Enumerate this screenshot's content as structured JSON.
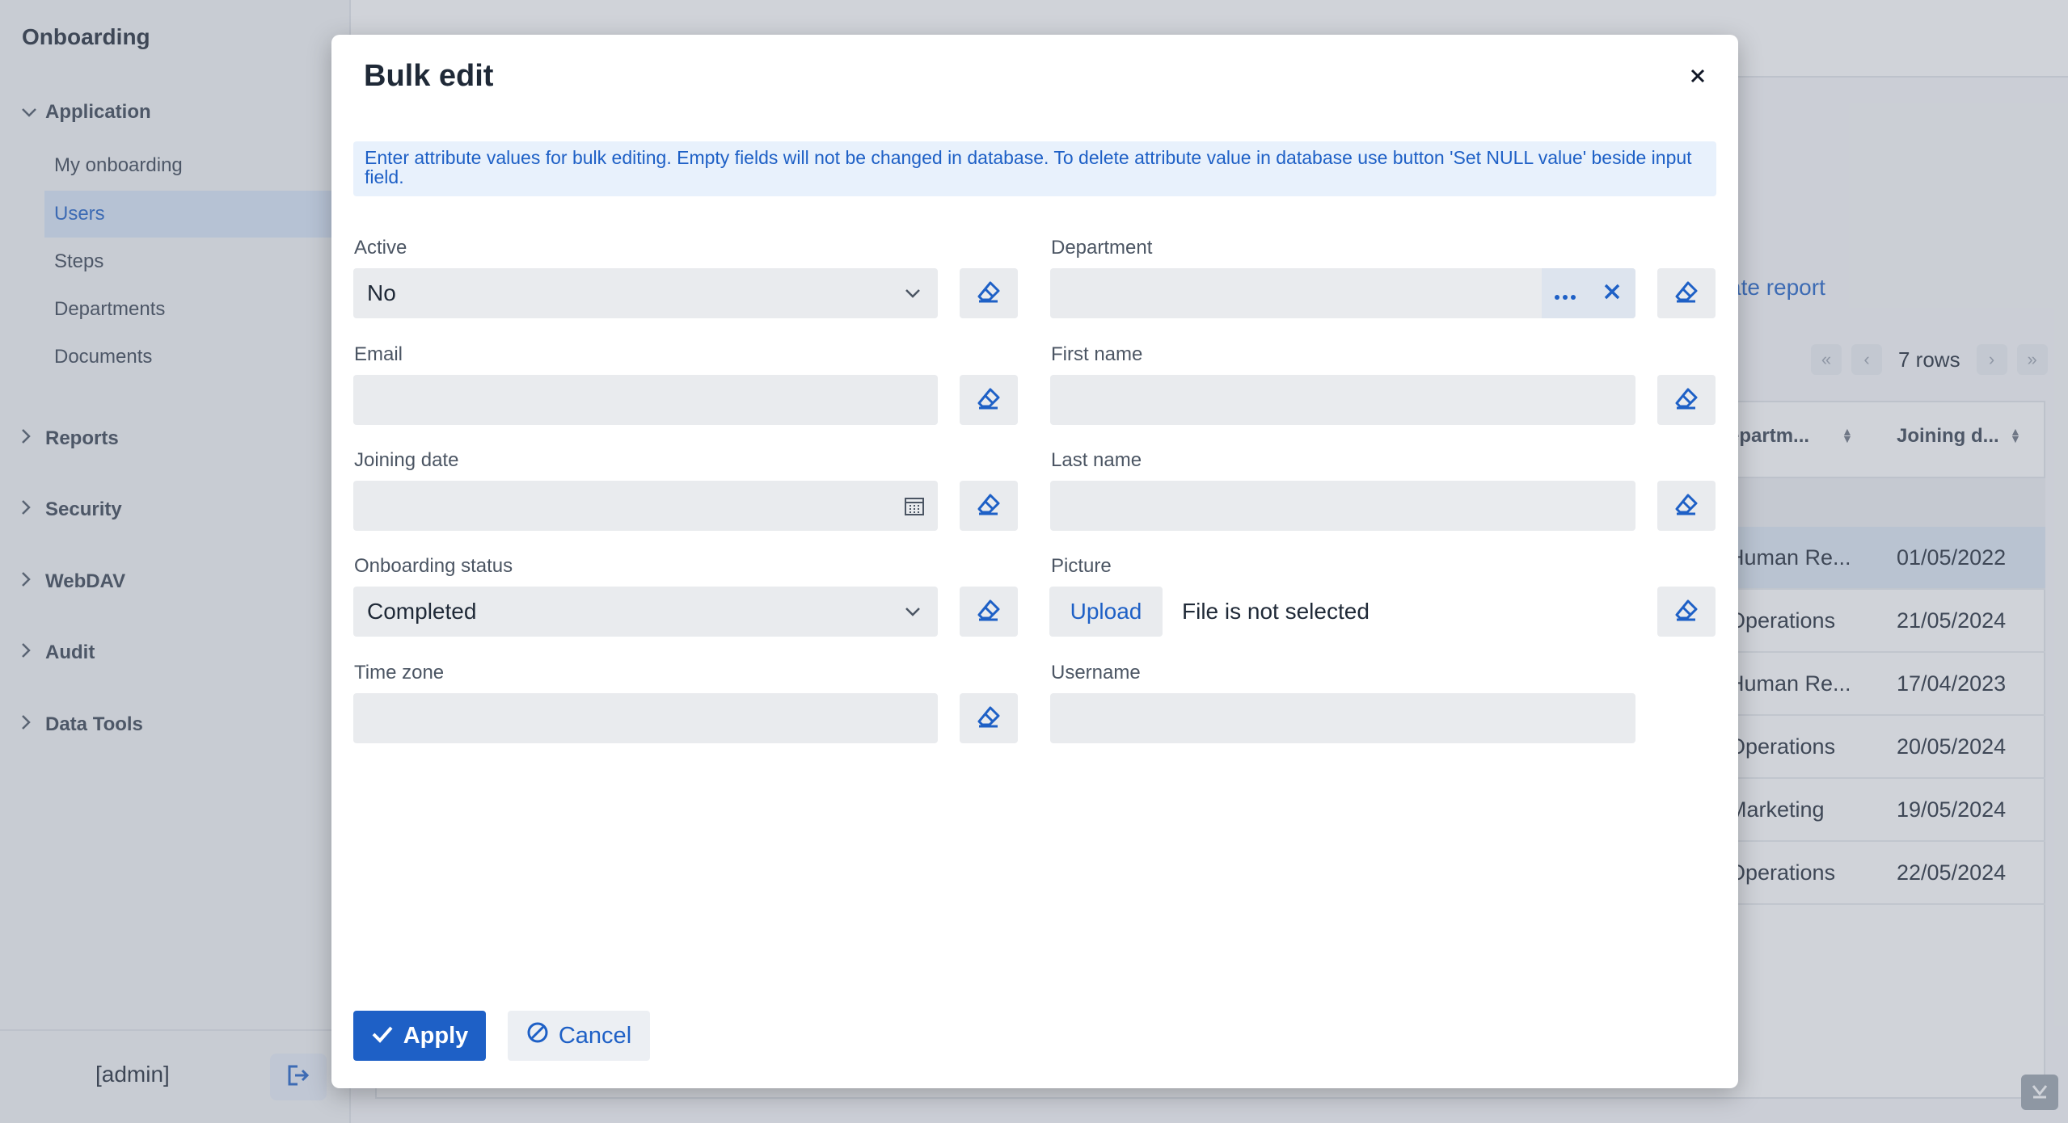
{
  "app": {
    "title": "Onboarding",
    "user": "[admin]"
  },
  "sidebar": {
    "groups": [
      {
        "label": "Application",
        "expanded": true
      },
      {
        "label": "Reports",
        "expanded": false
      },
      {
        "label": "Security",
        "expanded": false
      },
      {
        "label": "WebDAV",
        "expanded": false
      },
      {
        "label": "Audit",
        "expanded": false
      },
      {
        "label": "Data Tools",
        "expanded": false
      }
    ],
    "items": [
      {
        "label": "My onboarding"
      },
      {
        "label": "Users",
        "active": true
      },
      {
        "label": "Steps"
      },
      {
        "label": "Departments"
      },
      {
        "label": "Documents"
      }
    ]
  },
  "background": {
    "report_button_label": "ate report",
    "rows_count": "7 rows",
    "columns": [
      "epartm...",
      "Joining d..."
    ],
    "rows": [
      {
        "department": "Human Re...",
        "joining_date": "01/05/2022",
        "selected": true
      },
      {
        "department": "Operations",
        "joining_date": "21/05/2024"
      },
      {
        "department": "Human Re...",
        "joining_date": "17/04/2023"
      },
      {
        "department": "Operations",
        "joining_date": "20/05/2024"
      },
      {
        "department": "Marketing",
        "joining_date": "19/05/2024"
      },
      {
        "department": "Operations",
        "joining_date": "22/05/2024"
      }
    ]
  },
  "dialog": {
    "title": "Bulk edit",
    "info": "Enter attribute values for bulk editing. Empty fields will not be changed in database. To delete attribute value in database use button 'Set NULL value' beside input field.",
    "fields": {
      "active": {
        "label": "Active",
        "value": "No"
      },
      "department": {
        "label": "Department",
        "value": ""
      },
      "email": {
        "label": "Email",
        "value": ""
      },
      "first_name": {
        "label": "First name",
        "value": ""
      },
      "joining_date": {
        "label": "Joining date",
        "value": ""
      },
      "last_name": {
        "label": "Last name",
        "value": ""
      },
      "onboarding_status": {
        "label": "Onboarding status",
        "value": "Completed"
      },
      "picture": {
        "label": "Picture",
        "upload_label": "Upload",
        "status": "File is not selected"
      },
      "time_zone": {
        "label": "Time zone",
        "value": ""
      },
      "username": {
        "label": "Username",
        "value": ""
      }
    },
    "apply_label": "Apply",
    "cancel_label": "Cancel"
  },
  "colors": {
    "accent": "#1e60c6",
    "info_bg": "#e8f1fc",
    "field_bg": "#e9ebee"
  }
}
